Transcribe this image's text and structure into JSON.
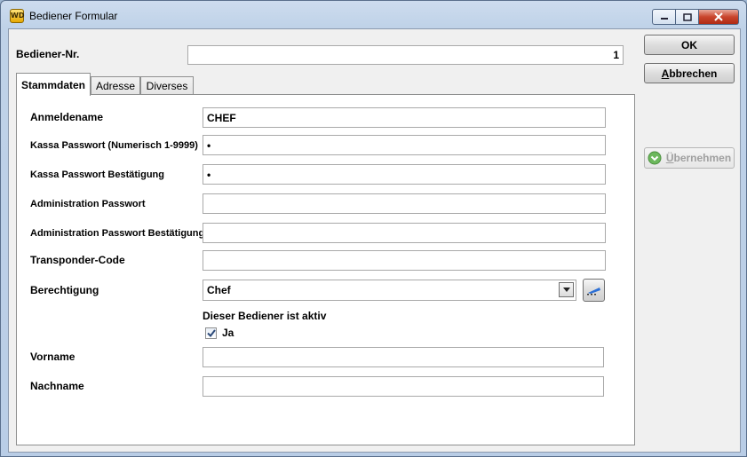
{
  "window": {
    "title": "Bediener Formular",
    "app_icon_text": "WD"
  },
  "header": {
    "operator_no_label": "Bediener-Nr.",
    "operator_no_value": "1"
  },
  "buttons": {
    "ok": "OK",
    "cancel_first": "A",
    "cancel_rest": "bbrechen",
    "apply_first": "Ü",
    "apply_rest": "bernehmen"
  },
  "tabs": [
    "Stammdaten",
    "Adresse",
    "Diverses"
  ],
  "form": {
    "login_name_label": "Anmeldename",
    "login_name_value": "CHEF",
    "pos_password_label": "Kassa Passwort (Numerisch 1-9999)",
    "pos_password_value": "•",
    "pos_password_confirm_label": "Kassa Passwort Bestätigung",
    "pos_password_confirm_value": "•",
    "admin_password_label": "Administration Passwort",
    "admin_password_value": "",
    "admin_password_confirm_label": "Administration Passwort Bestätigung",
    "admin_password_confirm_value": "",
    "transponder_label": "Transponder-Code",
    "transponder_value": "",
    "permission_label": "Berechtigung",
    "permission_value": "Chef",
    "active_label": "Dieser Bediener ist aktiv",
    "active_checkbox_label": "Ja",
    "active_checked": true,
    "firstname_label": "Vorname",
    "firstname_value": "",
    "lastname_label": "Nachname",
    "lastname_value": ""
  },
  "colors": {
    "title_bar": "#bfd2e8",
    "close_button": "#c9452d",
    "apply_icon": "#5aa84a"
  }
}
